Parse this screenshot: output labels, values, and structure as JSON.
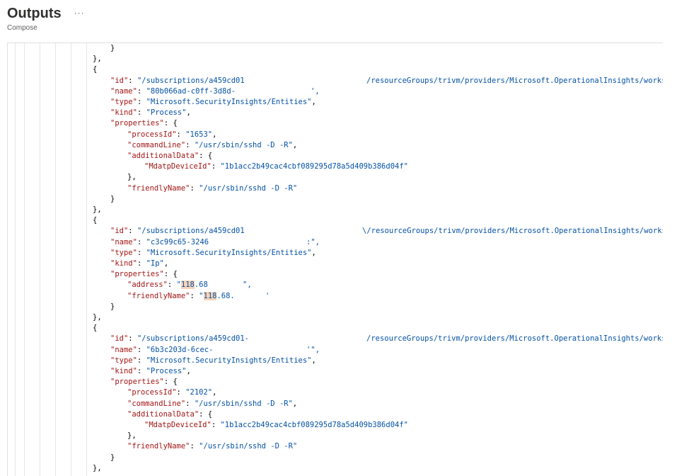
{
  "header": {
    "title": "Outputs",
    "more": "···",
    "subtitle": "Compose"
  },
  "lines": [
    {
      "indent": 2,
      "parts": [
        {
          "t": "}",
          "c": "p"
        }
      ]
    },
    {
      "indent": 1,
      "parts": [
        {
          "t": "},",
          "c": "p"
        }
      ]
    },
    {
      "indent": 1,
      "parts": [
        {
          "t": "{",
          "c": "p"
        }
      ]
    },
    {
      "indent": 2,
      "parts": [
        {
          "t": "\"id\"",
          "c": "k"
        },
        {
          "t": ": ",
          "c": "p"
        },
        {
          "t": "\"/subscriptions/a459cd01",
          "c": "s"
        }
      ],
      "tail": {
        "t": "/resourceGroups/trivm/providers/Microsoft.OperationalInsights/worksp",
        "c": "s",
        "col": 517
      }
    },
    {
      "indent": 2,
      "parts": [
        {
          "t": "\"name\"",
          "c": "k"
        },
        {
          "t": ": ",
          "c": "p"
        },
        {
          "t": "\"80b066ad-c0ff-3d8d-",
          "c": "s"
        }
      ],
      "tail": {
        "t": "',",
        "c": "s",
        "col": 438
      }
    },
    {
      "indent": 2,
      "parts": [
        {
          "t": "\"type\"",
          "c": "k"
        },
        {
          "t": ": ",
          "c": "p"
        },
        {
          "t": "\"Microsoft.SecurityInsights/Entities\"",
          "c": "s"
        },
        {
          "t": ",",
          "c": "p"
        }
      ]
    },
    {
      "indent": 2,
      "parts": [
        {
          "t": "\"kind\"",
          "c": "k"
        },
        {
          "t": ": ",
          "c": "p"
        },
        {
          "t": "\"Process\"",
          "c": "s"
        },
        {
          "t": ",",
          "c": "p"
        }
      ]
    },
    {
      "indent": 2,
      "parts": [
        {
          "t": "\"properties\"",
          "c": "k"
        },
        {
          "t": ": {",
          "c": "p"
        }
      ]
    },
    {
      "indent": 3,
      "parts": [
        {
          "t": "\"processId\"",
          "c": "k"
        },
        {
          "t": ": ",
          "c": "p"
        },
        {
          "t": "\"1653\"",
          "c": "s"
        },
        {
          "t": ",",
          "c": "p"
        }
      ]
    },
    {
      "indent": 3,
      "parts": [
        {
          "t": "\"commandLine\"",
          "c": "k"
        },
        {
          "t": ": ",
          "c": "p"
        },
        {
          "t": "\"/usr/sbin/sshd -D -R\"",
          "c": "s"
        },
        {
          "t": ",",
          "c": "p"
        }
      ]
    },
    {
      "indent": 3,
      "parts": [
        {
          "t": "\"additionalData\"",
          "c": "k"
        },
        {
          "t": ": {",
          "c": "p"
        }
      ]
    },
    {
      "indent": 4,
      "parts": [
        {
          "t": "\"MdatpDeviceId\"",
          "c": "k"
        },
        {
          "t": ": ",
          "c": "p"
        },
        {
          "t": "\"1b1acc2b49cac4cbf089295d78a5d409b386d04f\"",
          "c": "s"
        }
      ]
    },
    {
      "indent": 3,
      "parts": [
        {
          "t": "},",
          "c": "p"
        }
      ]
    },
    {
      "indent": 3,
      "parts": [
        {
          "t": "\"friendlyName\"",
          "c": "k"
        },
        {
          "t": ": ",
          "c": "p"
        },
        {
          "t": "\"/usr/sbin/sshd -D -R\"",
          "c": "s"
        }
      ]
    },
    {
      "indent": 2,
      "parts": [
        {
          "t": "}",
          "c": "p"
        }
      ]
    },
    {
      "indent": 1,
      "parts": [
        {
          "t": "},",
          "c": "p"
        }
      ]
    },
    {
      "indent": 1,
      "parts": [
        {
          "t": "{",
          "c": "p"
        }
      ]
    },
    {
      "indent": 2,
      "parts": [
        {
          "t": "\"id\"",
          "c": "k"
        },
        {
          "t": ": ",
          "c": "p"
        },
        {
          "t": "\"/subscriptions/a459cd01",
          "c": "s"
        }
      ],
      "tail": {
        "t": "\\/resourceGroups/trivm/providers/Microsoft.OperationalInsights/worksp",
        "c": "s",
        "col": 511
      }
    },
    {
      "indent": 2,
      "parts": [
        {
          "t": "\"name\"",
          "c": "k"
        },
        {
          "t": ": ",
          "c": "p"
        },
        {
          "t": "\"c3c99c65-3246",
          "c": "s"
        }
      ],
      "tail": {
        "t": ":\",",
        "c": "s",
        "col": 432
      }
    },
    {
      "indent": 2,
      "parts": [
        {
          "t": "\"type\"",
          "c": "k"
        },
        {
          "t": ": ",
          "c": "p"
        },
        {
          "t": "\"Microsoft.SecurityInsights/Entities\"",
          "c": "s"
        },
        {
          "t": ",",
          "c": "p"
        }
      ]
    },
    {
      "indent": 2,
      "parts": [
        {
          "t": "\"kind\"",
          "c": "k"
        },
        {
          "t": ": ",
          "c": "p"
        },
        {
          "t": "\"Ip\"",
          "c": "s"
        },
        {
          "t": ",",
          "c": "p"
        }
      ]
    },
    {
      "indent": 2,
      "parts": [
        {
          "t": "\"properties\"",
          "c": "k"
        },
        {
          "t": ": {",
          "c": "p"
        }
      ]
    },
    {
      "indent": 3,
      "parts": [
        {
          "t": "\"address\"",
          "c": "k"
        },
        {
          "t": ": ",
          "c": "p"
        },
        {
          "t": "\"",
          "c": "s"
        },
        {
          "t": "118",
          "c": "s",
          "hl": true
        },
        {
          "t": ".68",
          "c": "s"
        }
      ],
      "tail": {
        "t": "\",",
        "c": "s",
        "col": 342
      }
    },
    {
      "indent": 3,
      "parts": [
        {
          "t": "\"friendlyName\"",
          "c": "k"
        },
        {
          "t": ": ",
          "c": "p"
        },
        {
          "t": "\"",
          "c": "s"
        },
        {
          "t": "118",
          "c": "s",
          "hl": true
        },
        {
          "t": ".68.",
          "c": "s"
        }
      ],
      "tail": {
        "t": "'",
        "c": "s",
        "col": 374
      }
    },
    {
      "indent": 2,
      "parts": [
        {
          "t": "}",
          "c": "p"
        }
      ]
    },
    {
      "indent": 1,
      "parts": [
        {
          "t": "},",
          "c": "p"
        }
      ]
    },
    {
      "indent": 1,
      "parts": [
        {
          "t": "{",
          "c": "p"
        }
      ]
    },
    {
      "indent": 2,
      "parts": [
        {
          "t": "\"id\"",
          "c": "k"
        },
        {
          "t": ": ",
          "c": "p"
        },
        {
          "t": "\"/subscriptions/a459cd01-",
          "c": "s"
        }
      ],
      "tail": {
        "t": "/resourceGroups/trivm/providers/Microsoft.OperationalInsights/worksp",
        "c": "s",
        "col": 517
      }
    },
    {
      "indent": 2,
      "parts": [
        {
          "t": "\"name\"",
          "c": "k"
        },
        {
          "t": ": ",
          "c": "p"
        },
        {
          "t": "\"6b3c203d-6cec-",
          "c": "s"
        }
      ],
      "tail": {
        "t": "'\",",
        "c": "s",
        "col": 432
      }
    },
    {
      "indent": 2,
      "parts": [
        {
          "t": "\"type\"",
          "c": "k"
        },
        {
          "t": ": ",
          "c": "p"
        },
        {
          "t": "\"Microsoft.SecurityInsights/Entities\"",
          "c": "s"
        },
        {
          "t": ",",
          "c": "p"
        }
      ]
    },
    {
      "indent": 2,
      "parts": [
        {
          "t": "\"kind\"",
          "c": "k"
        },
        {
          "t": ": ",
          "c": "p"
        },
        {
          "t": "\"Process\"",
          "c": "s"
        },
        {
          "t": ",",
          "c": "p"
        }
      ]
    },
    {
      "indent": 2,
      "parts": [
        {
          "t": "\"properties\"",
          "c": "k"
        },
        {
          "t": ": {",
          "c": "p"
        }
      ]
    },
    {
      "indent": 3,
      "parts": [
        {
          "t": "\"processId\"",
          "c": "k"
        },
        {
          "t": ": ",
          "c": "p"
        },
        {
          "t": "\"2102\"",
          "c": "s"
        },
        {
          "t": ",",
          "c": "p"
        }
      ]
    },
    {
      "indent": 3,
      "parts": [
        {
          "t": "\"commandLine\"",
          "c": "k"
        },
        {
          "t": ": ",
          "c": "p"
        },
        {
          "t": "\"/usr/sbin/sshd -D -R\"",
          "c": "s"
        },
        {
          "t": ",",
          "c": "p"
        }
      ]
    },
    {
      "indent": 3,
      "parts": [
        {
          "t": "\"additionalData\"",
          "c": "k"
        },
        {
          "t": ": {",
          "c": "p"
        }
      ]
    },
    {
      "indent": 4,
      "parts": [
        {
          "t": "\"MdatpDeviceId\"",
          "c": "k"
        },
        {
          "t": ": ",
          "c": "p"
        },
        {
          "t": "\"1b1acc2b49cac4cbf089295d78a5d409b386d04f\"",
          "c": "s"
        }
      ]
    },
    {
      "indent": 3,
      "parts": [
        {
          "t": "},",
          "c": "p"
        }
      ]
    },
    {
      "indent": 3,
      "parts": [
        {
          "t": "\"friendlyName\"",
          "c": "k"
        },
        {
          "t": ": ",
          "c": "p"
        },
        {
          "t": "\"/usr/sbin/sshd -D -R\"",
          "c": "s"
        }
      ]
    },
    {
      "indent": 2,
      "parts": [
        {
          "t": "}",
          "c": "p"
        }
      ]
    },
    {
      "indent": 1,
      "parts": [
        {
          "t": "},",
          "c": "p"
        }
      ]
    }
  ]
}
